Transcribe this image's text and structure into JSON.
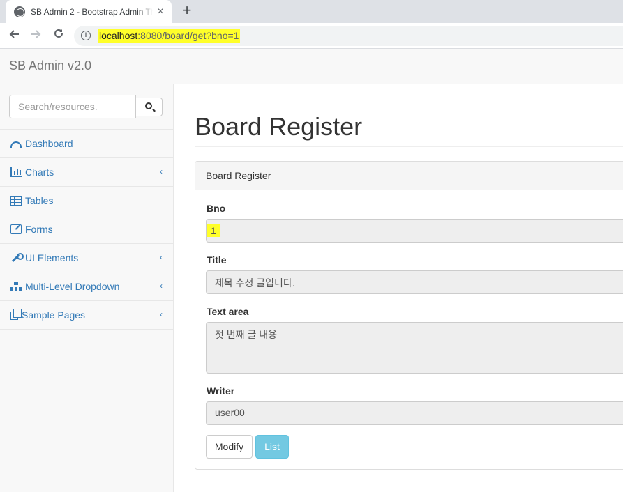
{
  "browser": {
    "tab_title": "SB Admin 2 - Bootstrap Admin Theme",
    "tab_close": "×",
    "new_tab": "+",
    "url_host": "localhost",
    "url_path": ":8080/board/get?bno=1",
    "highlight_color": "#ffff2a"
  },
  "navbar": {
    "brand": "SB Admin v2.0"
  },
  "sidebar": {
    "search_placeholder": "Search/resources.",
    "items": [
      {
        "label": "Dashboard",
        "icon": "dashboard-icon",
        "has_submenu": false
      },
      {
        "label": "Charts",
        "icon": "bar-chart-icon",
        "has_submenu": true
      },
      {
        "label": "Tables",
        "icon": "table-icon",
        "has_submenu": false
      },
      {
        "label": "Forms",
        "icon": "edit-icon",
        "has_submenu": false
      },
      {
        "label": "UI Elements",
        "icon": "wrench-icon",
        "has_submenu": true
      },
      {
        "label": "Multi-Level Dropdown",
        "icon": "sitemap-icon",
        "has_submenu": true
      },
      {
        "label": "Sample Pages",
        "icon": "files-icon",
        "has_submenu": true
      }
    ],
    "chevron": "‹"
  },
  "main": {
    "page_title": "Board Register",
    "panel_heading": "Board Register",
    "fields": {
      "bno": {
        "label": "Bno",
        "value": "1"
      },
      "title": {
        "label": "Title",
        "value": "제목 수정 글입니다."
      },
      "content": {
        "label": "Text area",
        "value": "첫 번째 글 내용"
      },
      "writer": {
        "label": "Writer",
        "value": "user00"
      }
    },
    "buttons": {
      "modify": "Modify",
      "list": "List"
    }
  },
  "colors": {
    "link": "#337ab7",
    "info_button": "#5bc0de",
    "readonly_bg": "#eeeeee"
  }
}
